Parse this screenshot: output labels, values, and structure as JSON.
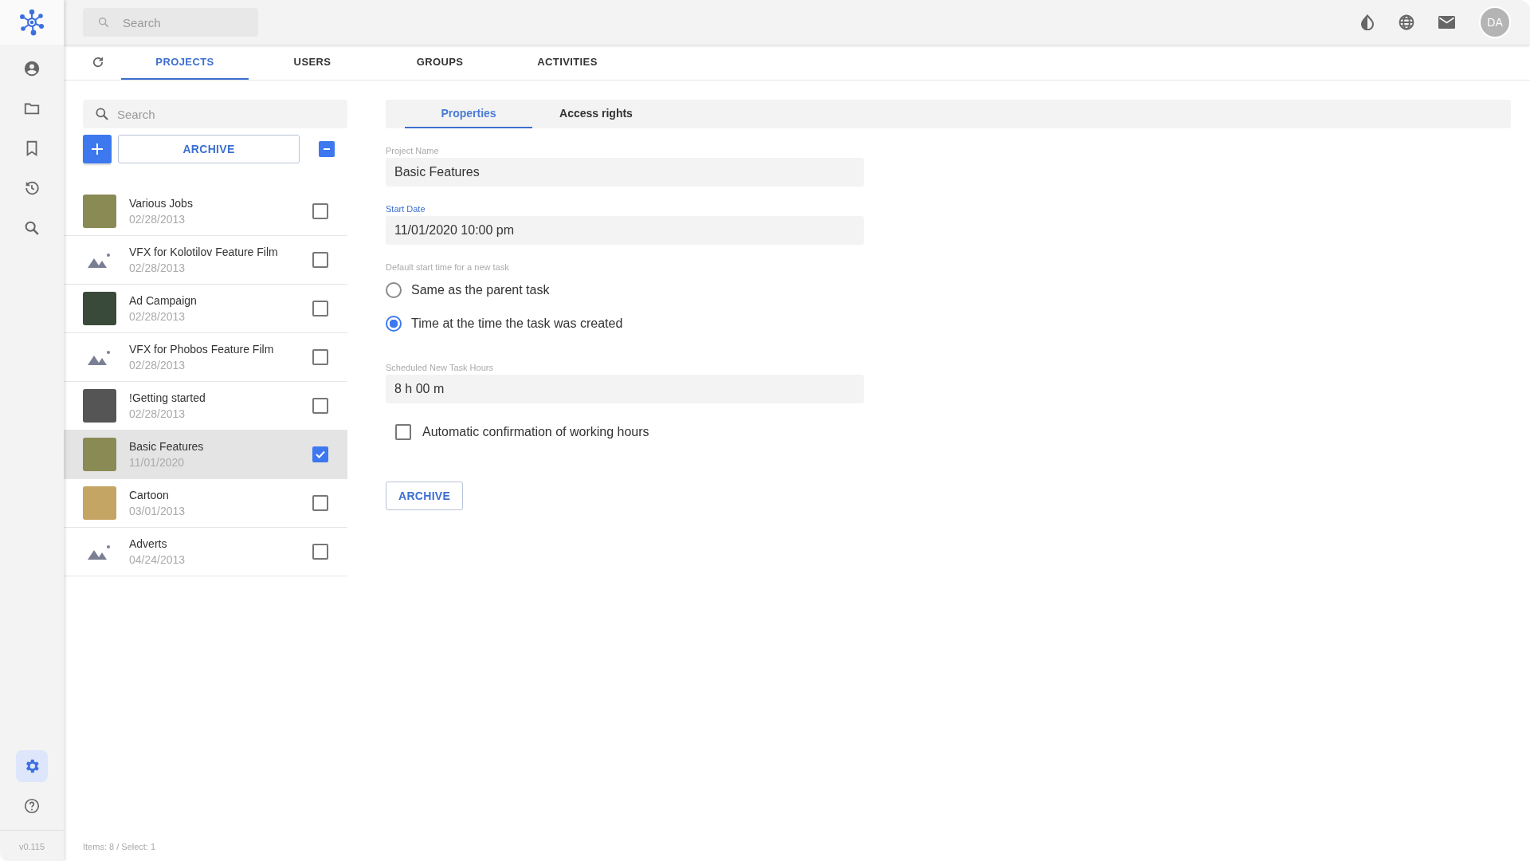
{
  "top_bar": {
    "search": {
      "placeholder": "Search"
    },
    "avatar": "DA"
  },
  "rail": [
    {
      "kind": "user",
      "selected": false
    },
    {
      "kind": "folder",
      "selected": false
    },
    {
      "kind": "bookmark",
      "selected": false
    },
    {
      "kind": "history",
      "selected": false
    },
    {
      "kind": "search",
      "selected": false
    }
  ],
  "rail_bottom": [
    {
      "kind": "settings",
      "selected": true
    },
    {
      "kind": "help",
      "selected": false
    }
  ],
  "version": "v0.115",
  "tabs": [
    {
      "label": "PROJECTS",
      "selected": true
    },
    {
      "label": "USERS",
      "selected": false
    },
    {
      "label": "GROUPS",
      "selected": false
    },
    {
      "label": "ACTIVITIES",
      "selected": false
    }
  ],
  "list": {
    "search": {
      "placeholder": "Search"
    },
    "archive_button": "ARCHIVE",
    "select_all": {
      "indeterminate": true
    }
  },
  "projects": [
    {
      "name": "Various Jobs",
      "date": "02/28/2013",
      "kind": "photo",
      "selected": false,
      "checked": false
    },
    {
      "name": "VFX for Kolotilov Feature Film",
      "date": "02/28/2013",
      "kind": "placeholder",
      "selected": false,
      "checked": false
    },
    {
      "name": "Ad Campaign",
      "date": "02/28/2013",
      "kind": "photo",
      "selected": false,
      "checked": false
    },
    {
      "name": "VFX for Phobos Feature Film",
      "date": "02/28/2013",
      "kind": "placeholder",
      "selected": false,
      "checked": false
    },
    {
      "name": "!Getting started",
      "date": "02/28/2013",
      "kind": "photo",
      "selected": false,
      "checked": false
    },
    {
      "name": "Basic Features",
      "date": "11/01/2020",
      "kind": "photo",
      "selected": true,
      "checked": true
    },
    {
      "name": "Cartoon",
      "date": "03/01/2013",
      "kind": "photo",
      "selected": false,
      "checked": false
    },
    {
      "name": "Adverts",
      "date": "04/24/2013",
      "kind": "placeholder",
      "selected": false,
      "checked": false
    }
  ],
  "status_bar": "Items: 8 / Select: 1",
  "detail": {
    "tabs": [
      {
        "label": "Properties",
        "selected": true
      },
      {
        "label": "Access rights",
        "selected": false
      }
    ],
    "project_name": {
      "label": "Project Name",
      "value": "Basic Features",
      "focused": false
    },
    "start_date": {
      "label": "Start Date",
      "value": "11/01/2020 10:00 pm",
      "focused": true
    },
    "start_time": {
      "label": "Default start time for a new task",
      "options": [
        {
          "label": "Same as the parent task",
          "selected": false
        },
        {
          "label": "Time at the time the task was created",
          "selected": true
        }
      ]
    },
    "task_hours": {
      "label": "Scheduled New Task Hours",
      "value": "8 h 00 m",
      "focused": false
    },
    "auto_confirm": {
      "label": "Automatic confirmation of working hours",
      "checked": false
    },
    "archive_button": "ARCHIVE"
  }
}
